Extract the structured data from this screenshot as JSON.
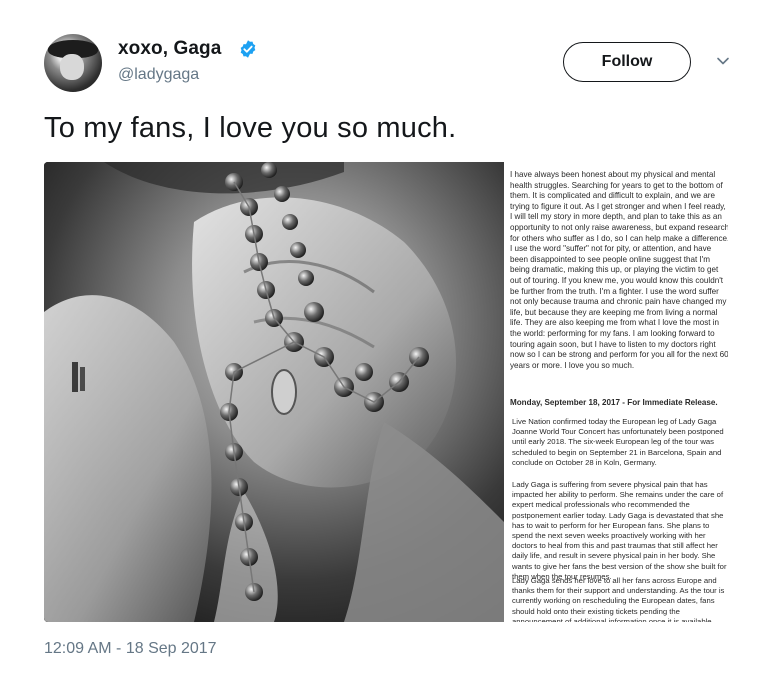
{
  "account": {
    "display_name": "xoxo, Gaga",
    "handle": "@ladygaga",
    "verified": true,
    "avatar_icon": "profile-avatar"
  },
  "actions": {
    "follow_label": "Follow",
    "more_icon": "chevron-down-icon"
  },
  "tweet": {
    "text": "To my fans, I love you so much.",
    "timestamp": "12:09 AM - 18 Sep 2017"
  },
  "media": {
    "photo_icon": "photo-hands-rosary",
    "letter": {
      "paragraph_1": "I have always been honest about my physical and mental health struggles. Searching for years to get to the bottom of them. It is complicated and difficult to explain, and we are trying to figure it out. As I get stronger and when I feel ready, I will tell my story in more depth, and plan to take this as an opportunity to not only raise awareness, but expand research for others who suffer as I do, so I can help make a difference. I use the word \"suffer\" not for pity, or attention, and have been disappointed to see people online suggest that I'm being dramatic, making this up, or playing the victim to get out of touring. If you knew me, you would know this couldn't be further from the truth. I'm a fighter. I use the word suffer not only because trauma and chronic pain have changed my life, but because they are keeping me from living a normal life. They are also keeping me from what I love the most in the world: performing for my fans. I am looking forward to touring again soon, but I have to listen to my doctors right now so I can be strong and perform for you all for the next 60 years or more. I love you so much.",
      "dateline": "Monday, September 18, 2017 - For Immediate Release.",
      "paragraph_2": "Live Nation confirmed today the European leg of Lady Gaga Joanne World Tour Concert has unfortunately been postponed until early 2018. The six-week European leg of the tour was scheduled to begin on September 21 in Barcelona, Spain and conclude on October 28 in Koln, Germany.",
      "paragraph_3": "Lady Gaga is suffering from severe physical pain that has impacted her ability to perform. She remains under the care of expert medical professionals who recommended the postponement earlier today. Lady Gaga is devastated that she has to wait to perform for her European fans. She plans to spend the next seven weeks proactively working with her doctors to heal from this and past traumas that still affect her daily life, and result in severe physical pain in her body. She wants to give her fans the best version of the show she built for them when the tour resumes.",
      "paragraph_4": "Lady Gaga sends her love to all her fans across Europe and thanks them for their support and understanding. As the tour is currently working on rescheduling the European dates, fans should hold onto their existing tickets pending the announcement of additional information once it is available."
    }
  },
  "colors": {
    "verified_blue": "#1da1f2",
    "secondary_text": "#657786",
    "primary_text": "#14171a"
  }
}
